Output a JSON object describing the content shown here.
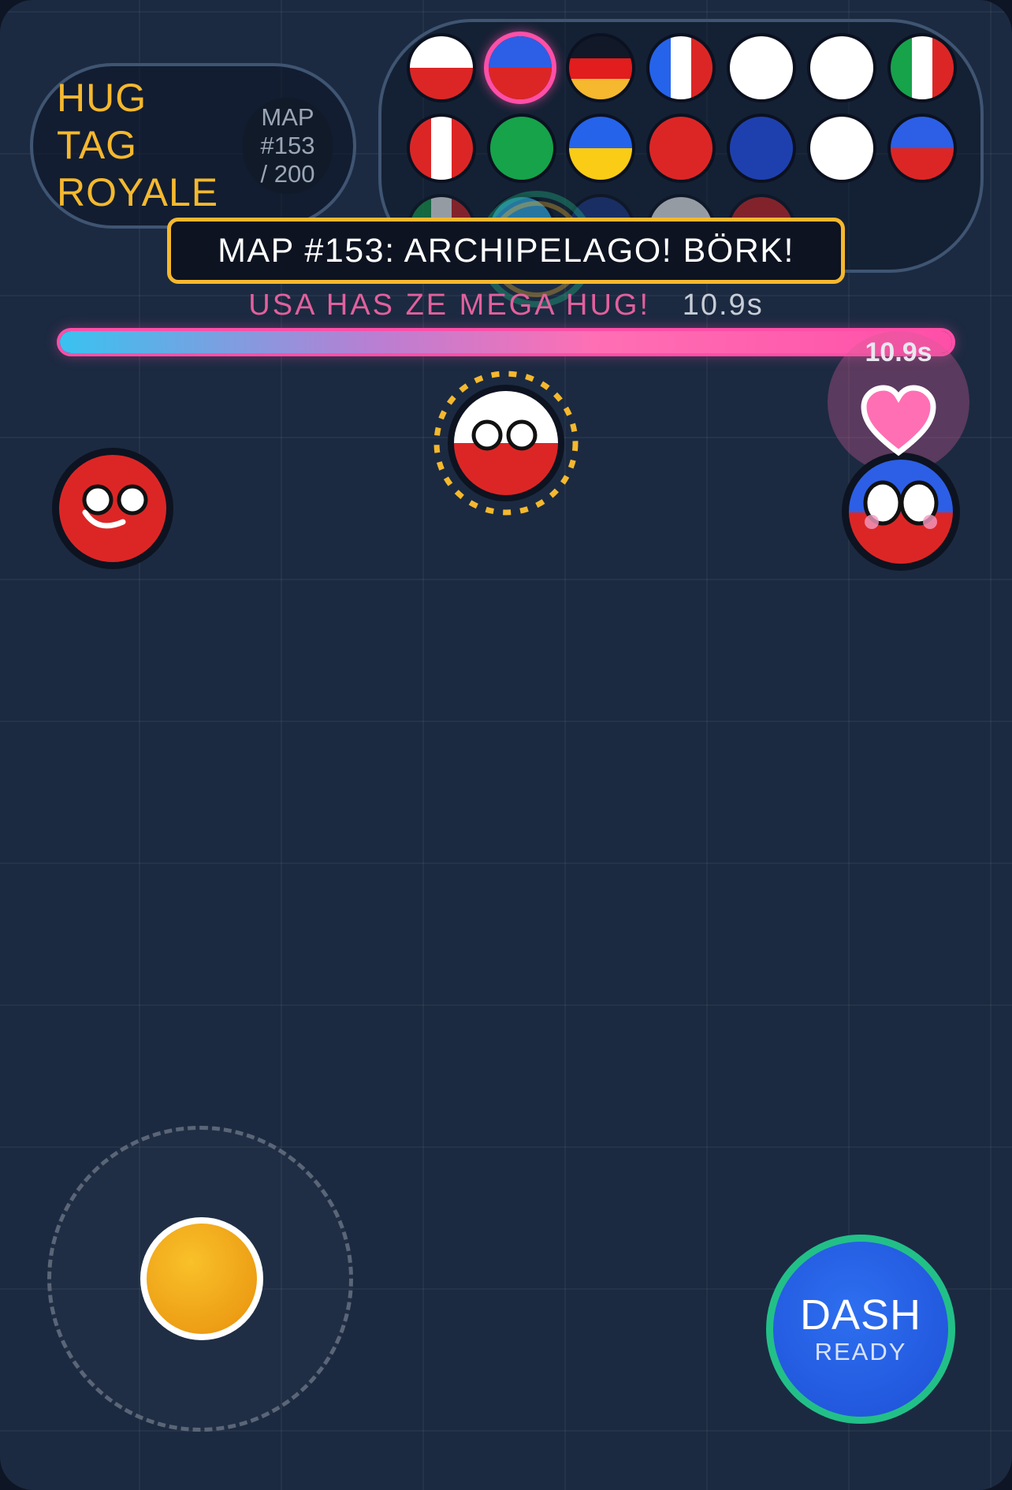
{
  "game": {
    "title_lines": [
      "HUG",
      "TAG",
      "ROYALE"
    ],
    "map_badge": [
      "MAP",
      "#153",
      "/ 200"
    ]
  },
  "banner": {
    "map_announcement": "MAP #153: ARCHIPELAGO! BÖRK!"
  },
  "mega_hug": {
    "status_text": "USA HAS ZE MEGA HUG!",
    "timer": "10.9s",
    "marker_timer": "10.9s",
    "progress_fraction": 1.0,
    "heart_icon": "heart-icon"
  },
  "roster": {
    "rows": [
      [
        "poland",
        "haiti-selected",
        "germany",
        "france",
        "blank",
        "blank",
        "italy"
      ],
      [
        "peru",
        "green",
        "ukraine",
        "red",
        "blue",
        "blank",
        "haiti"
      ],
      [
        "mexico",
        "argentina",
        "navy",
        "white",
        "red-2"
      ]
    ]
  },
  "controls": {
    "dash_label": "DASH",
    "dash_status": "READY"
  },
  "colors": {
    "accent_gold": "#f5b82e",
    "mega_pink": "#ff4fa8",
    "dash_blue": "#1d4fd6",
    "dash_ring": "#22c088",
    "background": "#1b2a41"
  }
}
